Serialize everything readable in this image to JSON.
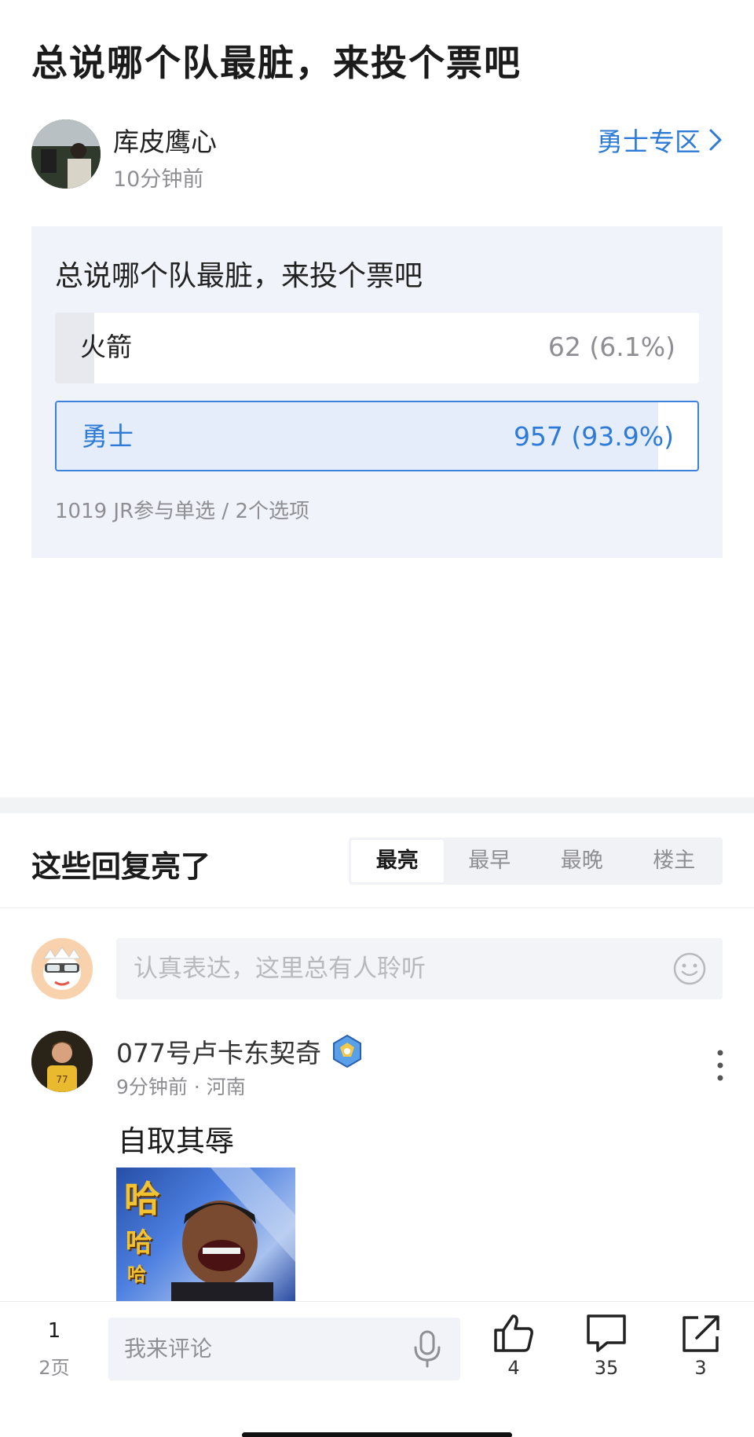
{
  "post": {
    "title": "总说哪个队最脏，来投个票吧",
    "author": "库皮鹰心",
    "time": "10分钟前",
    "zone_link": "勇士专区"
  },
  "poll": {
    "question": "总说哪个队最脏，来投个票吧",
    "options": [
      {
        "label": "火箭",
        "result": "62 (6.1%)",
        "percent": 6.1,
        "selected": false
      },
      {
        "label": "勇士",
        "result": "957 (93.9%)",
        "percent": 93.9,
        "selected": true
      }
    ],
    "meta": "1019 JR参与单选 / 2个选项"
  },
  "replies": {
    "section_title": "这些回复亮了",
    "sort_tabs": [
      "最亮",
      "最早",
      "最晚",
      "楼主"
    ],
    "active_tab": "最亮",
    "input_placeholder": "认真表达，这里总有人聆听",
    "first": {
      "user": "077号卢卡东契奇",
      "meta": "9分钟前 · 河南",
      "text": "自取其辱",
      "image_text": [
        "哈",
        "哈",
        "哈"
      ]
    }
  },
  "bottom_bar": {
    "page_current": "1",
    "page_total": "2页",
    "comment_placeholder": "我来评论",
    "likes": "4",
    "comments": "35",
    "shares": "3"
  },
  "colors": {
    "accent": "#2d7bd6",
    "panel": "#f1f3fa"
  }
}
